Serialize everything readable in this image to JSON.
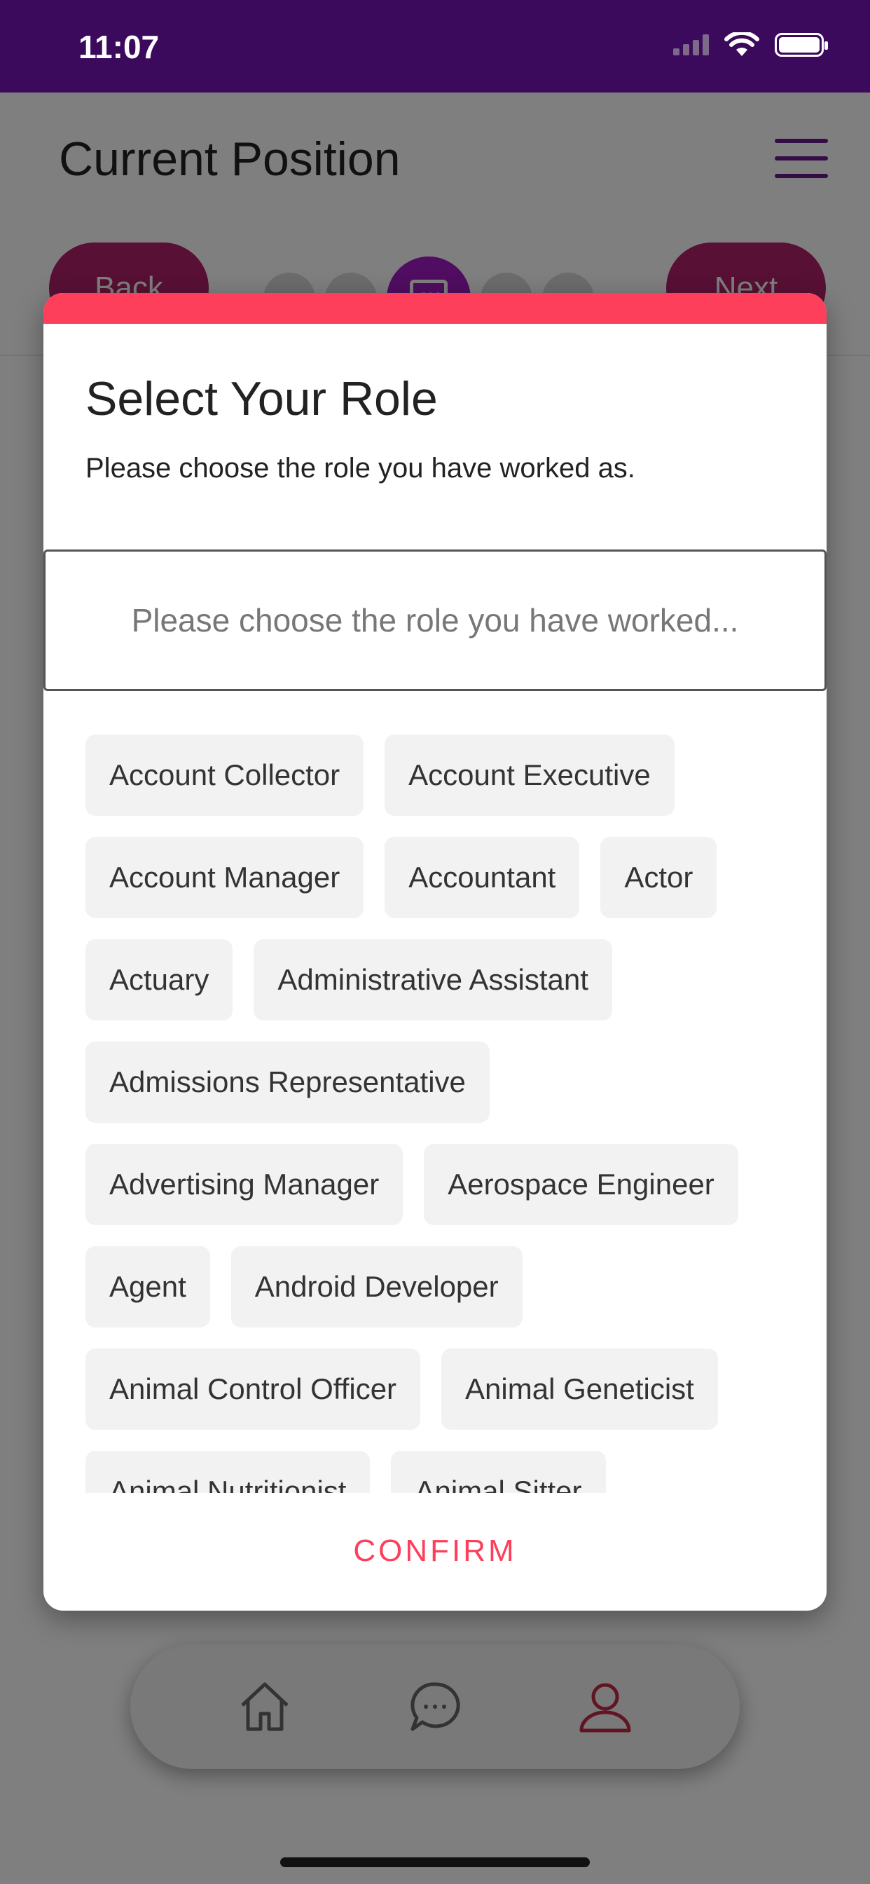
{
  "status_bar": {
    "time": "11:07"
  },
  "page": {
    "title": "Current Position",
    "back_label": "Back",
    "next_label": "Next",
    "step_icon_text": "CV"
  },
  "modal": {
    "title": "Select Your Role",
    "subtitle": "Please choose the role you have worked as.",
    "search_placeholder": "Please choose the role you have worked...",
    "confirm_label": "CONFIRM",
    "roles": [
      "Account Collector",
      "Account Executive",
      "Account Manager",
      "Accountant",
      "Actor",
      "Actuary",
      "Administrative Assistant",
      "Admissions Representative",
      "Advertising Manager",
      "Aerospace Engineer",
      "Agent",
      "Android Developer",
      "Animal Control Officer",
      "Animal Geneticist",
      "Animal Nutritionist",
      "Animal Sitter"
    ]
  },
  "colors": {
    "accent": "#fd3f5b",
    "brand_purple": "#3c0a5c",
    "step_active": "#a11ac2"
  }
}
